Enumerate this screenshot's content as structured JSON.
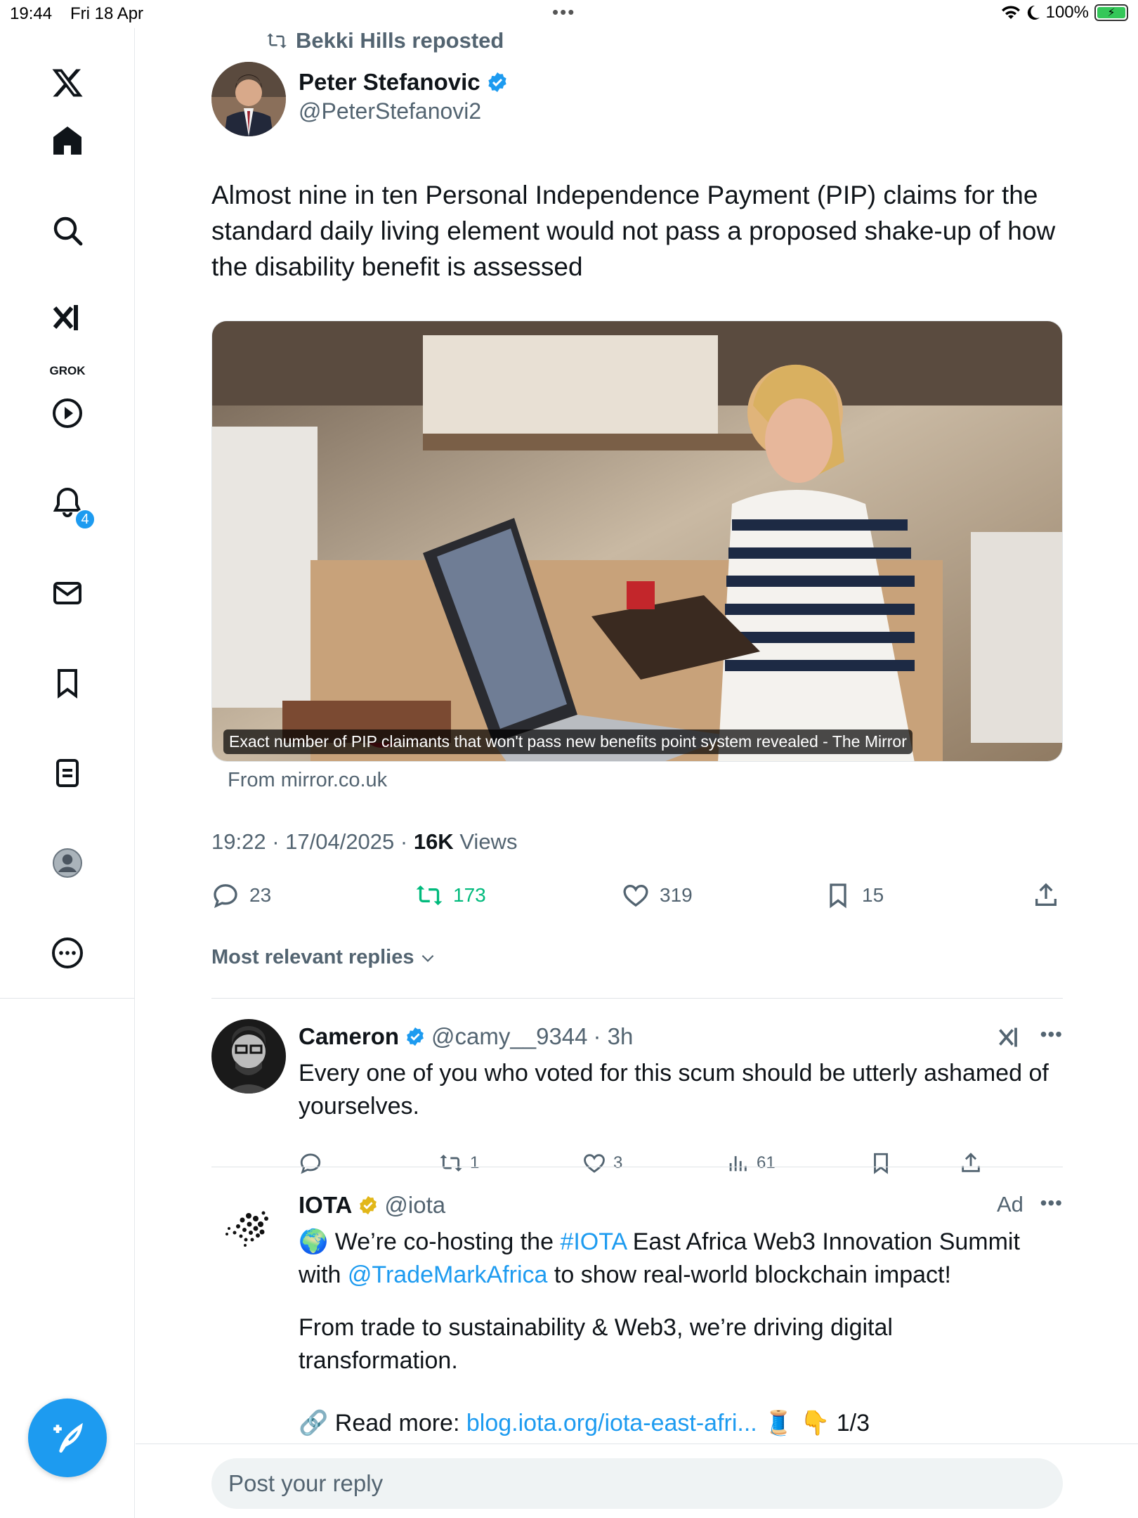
{
  "status_bar": {
    "time": "19:44",
    "date": "Fri 18 Apr",
    "battery": "100%"
  },
  "sidebar": {
    "logo": "x-logo-icon",
    "items": [
      {
        "name": "home-icon"
      },
      {
        "name": "search-icon"
      },
      {
        "name": "grok-icon",
        "label": "GROK"
      },
      {
        "name": "video-icon"
      },
      {
        "name": "notifications-icon",
        "badge": "4"
      },
      {
        "name": "messages-icon"
      },
      {
        "name": "bookmarks-icon"
      },
      {
        "name": "lists-icon"
      },
      {
        "name": "profile-icon"
      },
      {
        "name": "more-icon"
      }
    ],
    "compose": "compose-icon"
  },
  "tweet": {
    "reposted_by": "Bekki Hills reposted",
    "author_name": "Peter Stefanovic",
    "author_handle": "@PeterStefanovi2",
    "text": "Almost nine in ten Personal Independence Payment (PIP) claims for the standard daily living element would not pass a proposed shake-up of how the disability benefit is assessed",
    "card_caption": "Exact number of PIP claimants that won't pass new benefits point system revealed - The Mirror",
    "card_source": "From mirror.co.uk",
    "time": "19:22 · 17/04/2025 · ",
    "views_count": "16K",
    "views_label": " Views",
    "replies": "23",
    "reposts": "173",
    "likes": "319",
    "bookmarks": "15",
    "accent_color": "#1d9bf0",
    "repost_color": "#00ba7c"
  },
  "replies_filter": "Most relevant replies",
  "replies": [
    {
      "name": "Cameron",
      "handle": "@camy__9344",
      "time": "· 3h",
      "text": "Every one of you who voted for this scum should be utterly ashamed of yourselves.",
      "reposts": "1",
      "likes": "3",
      "views": "61"
    }
  ],
  "ad": {
    "name": "IOTA",
    "handle": "@iota",
    "label": "Ad",
    "line1_pre": "🌍 We’re co-hosting the ",
    "line1_tag": "#IOTA",
    "line1_post": " East Africa Web3 Innovation Summit",
    "line2_pre": "with ",
    "line2_mention": "@TradeMarkAfrica",
    "line2_post": " to show real-world blockchain impact!",
    "para2": "From trade to sustainability & Web3, we’re driving digital transformation.",
    "read_more_pre": "🔗 Read more: ",
    "read_more_link": "blog.iota.org/iota-east-afri...",
    "read_more_post": " 🧵 👇 1/3"
  },
  "reply_box": {
    "placeholder": "Post your reply"
  }
}
